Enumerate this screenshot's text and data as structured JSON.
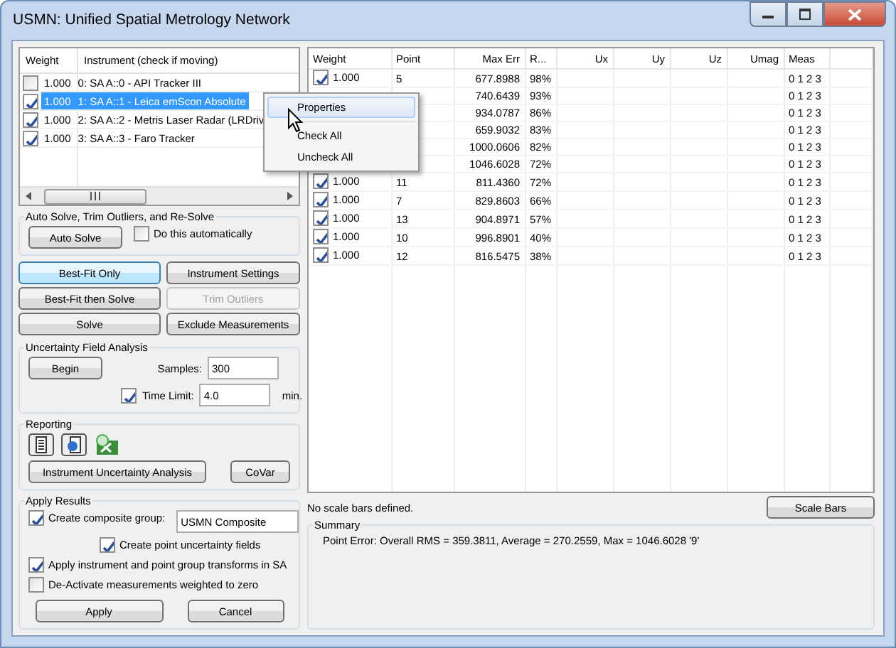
{
  "window": {
    "title": "USMN: Unified Spatial Metrology Network"
  },
  "instruments": {
    "columns": [
      "Weight",
      "Instrument (check if moving)"
    ],
    "rows": [
      {
        "checked": false,
        "selected": false,
        "weight": "1.000",
        "name": "0: SA A::0 - API Tracker III"
      },
      {
        "checked": true,
        "selected": true,
        "weight": "1.000",
        "name": "1: SA A::1 - Leica emScon Absolute"
      },
      {
        "checked": true,
        "selected": false,
        "weight": "1.000",
        "name": "2: SA A::2 - Metris Laser Radar (LRDriv"
      },
      {
        "checked": true,
        "selected": false,
        "weight": "1.000",
        "name": "3: SA A::3 - Faro Tracker"
      }
    ]
  },
  "context_menu": {
    "items": [
      {
        "label": "Properties",
        "selected": true,
        "kind": "item"
      },
      {
        "label": "Check All",
        "selected": false,
        "kind": "item"
      },
      {
        "label": "Uncheck All",
        "selected": false,
        "kind": "item"
      }
    ]
  },
  "auto_solve": {
    "title": "Auto Solve, Trim Outliers, and Re-Solve",
    "button": "Auto Solve",
    "automatic": {
      "label": "Do this automatically",
      "checked": false
    }
  },
  "solve_buttons": [
    {
      "label": "Best-Fit Only",
      "selected": true,
      "disabled": false
    },
    {
      "label": "Instrument Settings",
      "selected": false,
      "disabled": false
    },
    {
      "label": "Best-Fit then Solve",
      "selected": false,
      "disabled": false
    },
    {
      "label": "Trim Outliers",
      "selected": false,
      "disabled": true
    },
    {
      "label": "Solve",
      "selected": false,
      "disabled": false
    },
    {
      "label": "Exclude Measurements",
      "selected": false,
      "disabled": false
    }
  ],
  "uncertainty": {
    "title": "Uncertainty Field Analysis",
    "button": "Begin",
    "samples": {
      "label": "Samples:",
      "value": "300"
    },
    "time_limit": {
      "checked": true,
      "label": "Time Limit:",
      "value": "4.0",
      "unit": "min."
    }
  },
  "reporting": {
    "title": "Reporting",
    "buttons": [
      "Instrument Uncertainty Analysis",
      "CoVar"
    ]
  },
  "apply_results": {
    "title": "Apply Results",
    "composite": {
      "checked": true,
      "label": "Create composite group:",
      "value": "USMN Composite"
    },
    "options": [
      {
        "kind": "indented",
        "checked": true,
        "label": "Create point uncertainty fields"
      },
      {
        "kind": "normal",
        "checked": true,
        "label": "Apply instrument and point group transforms in SA"
      },
      {
        "kind": "normal",
        "checked": false,
        "label": "De-Activate measurements weighted to zero"
      }
    ],
    "buttons": [
      "Apply",
      "Cancel"
    ]
  },
  "points": {
    "columns": [
      "Weight",
      "Point",
      "Max Err",
      "R...",
      "Ux",
      "Uy",
      "Uz",
      "Umag",
      "Meas"
    ],
    "rows": [
      {
        "checked": true,
        "weight": "1.000",
        "point": "5",
        "max_err": "677.8988",
        "r": "98%",
        "meas": "0 1 2 3"
      },
      {
        "max_err": "740.6439",
        "r": "93%",
        "meas": "0 1 2 3"
      },
      {
        "max_err": "934.0787",
        "r": "86%",
        "meas": "0 1 2 3"
      },
      {
        "max_err": "659.9032",
        "r": "83%",
        "meas": "0 1 2 3"
      },
      {
        "max_err": "1000.0606",
        "r": "82%",
        "meas": "0 1 2 3"
      },
      {
        "max_err": "1046.6028",
        "r": "72%",
        "meas": "0 1 2 3"
      },
      {
        "checked": true,
        "weight": "1.000",
        "point": "11",
        "max_err": "811.4360",
        "r": "72%",
        "meas": "0 1 2 3"
      },
      {
        "checked": true,
        "weight": "1.000",
        "point": "7",
        "max_err": "829.8603",
        "r": "66%",
        "meas": "0 1 2 3"
      },
      {
        "checked": true,
        "weight": "1.000",
        "point": "13",
        "max_err": "904.8971",
        "r": "57%",
        "meas": "0 1 2 3"
      },
      {
        "checked": true,
        "weight": "1.000",
        "point": "10",
        "max_err": "996.8901",
        "r": "40%",
        "meas": "0 1 2 3"
      },
      {
        "checked": true,
        "weight": "1.000",
        "point": "12",
        "max_err": "816.5475",
        "r": "38%",
        "meas": "0 1 2 3"
      }
    ]
  },
  "scale_bars": {
    "message": "No scale bars defined.",
    "button": "Scale Bars"
  },
  "summary": {
    "title": "Summary",
    "text": "Point Error: Overall RMS = 359.3811, Average = 270.2559, Max = 1046.6028 '9'"
  }
}
